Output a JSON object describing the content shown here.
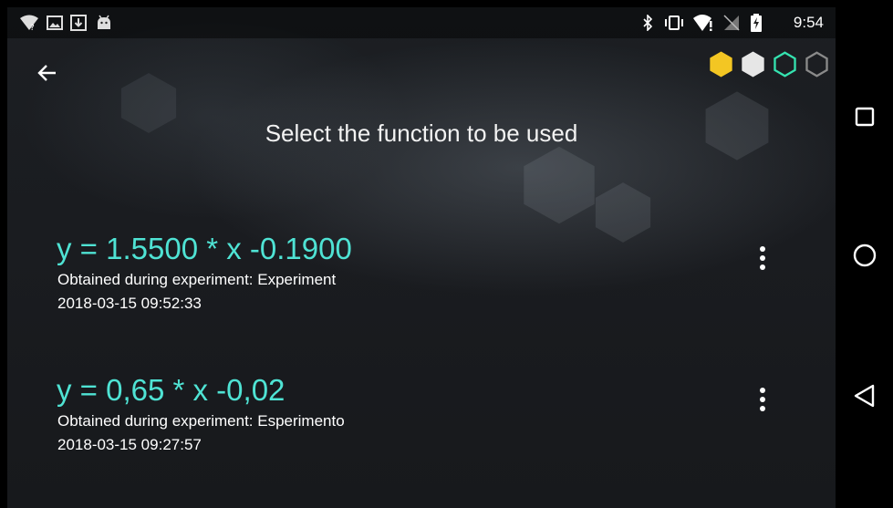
{
  "status_bar": {
    "time": "9:54",
    "left_icons": [
      "wifi-question-icon",
      "image-icon",
      "download-icon",
      "android-icon"
    ],
    "right_icons": [
      "bluetooth-icon",
      "vibrate-icon",
      "wifi-alert-icon",
      "no-sim-icon",
      "battery-charging-icon"
    ]
  },
  "app_bar": {
    "back_icon": "arrow-left-icon",
    "progress_steps": [
      {
        "state": "filled",
        "color": "#f3c623"
      },
      {
        "state": "filled",
        "color": "#e6e6e6"
      },
      {
        "state": "outline",
        "color": "#35e3b0"
      },
      {
        "state": "outline",
        "color": "#8a8a8a"
      }
    ]
  },
  "main": {
    "title": "Select the function to be used",
    "functions": [
      {
        "equation": "y = 1.5500 * x -0.1900",
        "experiment": "Obtained during experiment: Experiment",
        "date": "2018-03-15 09:52:33",
        "menu_icon": "more-vert-icon"
      },
      {
        "equation": "y = 0,65 * x -0,02",
        "experiment": "Obtained during experiment: Esperimento",
        "date": "2018-03-15 09:27:57",
        "menu_icon": "more-vert-icon"
      }
    ]
  },
  "nav_bar": {
    "buttons": [
      "recents-square-icon",
      "home-circle-icon",
      "back-triangle-icon"
    ]
  },
  "colors": {
    "accent": "#4fe3d4",
    "background": "#1b1d21",
    "text": "#ffffff"
  }
}
